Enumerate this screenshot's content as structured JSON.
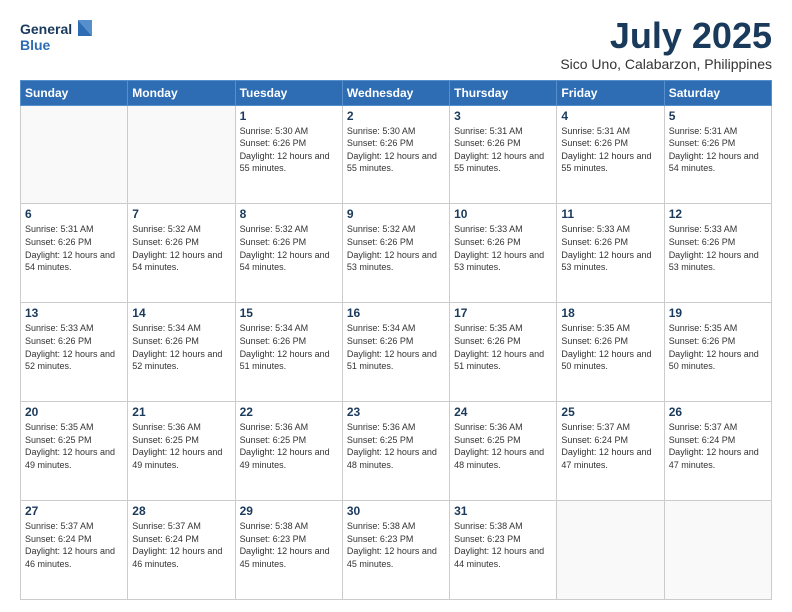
{
  "logo": {
    "line1": "General",
    "line2": "Blue"
  },
  "title": "July 2025",
  "subtitle": "Sico Uno, Calabarzon, Philippines",
  "weekdays": [
    "Sunday",
    "Monday",
    "Tuesday",
    "Wednesday",
    "Thursday",
    "Friday",
    "Saturday"
  ],
  "weeks": [
    [
      {
        "day": "",
        "info": ""
      },
      {
        "day": "",
        "info": ""
      },
      {
        "day": "1",
        "info": "Sunrise: 5:30 AM\nSunset: 6:26 PM\nDaylight: 12 hours and 55 minutes."
      },
      {
        "day": "2",
        "info": "Sunrise: 5:30 AM\nSunset: 6:26 PM\nDaylight: 12 hours and 55 minutes."
      },
      {
        "day": "3",
        "info": "Sunrise: 5:31 AM\nSunset: 6:26 PM\nDaylight: 12 hours and 55 minutes."
      },
      {
        "day": "4",
        "info": "Sunrise: 5:31 AM\nSunset: 6:26 PM\nDaylight: 12 hours and 55 minutes."
      },
      {
        "day": "5",
        "info": "Sunrise: 5:31 AM\nSunset: 6:26 PM\nDaylight: 12 hours and 54 minutes."
      }
    ],
    [
      {
        "day": "6",
        "info": "Sunrise: 5:31 AM\nSunset: 6:26 PM\nDaylight: 12 hours and 54 minutes."
      },
      {
        "day": "7",
        "info": "Sunrise: 5:32 AM\nSunset: 6:26 PM\nDaylight: 12 hours and 54 minutes."
      },
      {
        "day": "8",
        "info": "Sunrise: 5:32 AM\nSunset: 6:26 PM\nDaylight: 12 hours and 54 minutes."
      },
      {
        "day": "9",
        "info": "Sunrise: 5:32 AM\nSunset: 6:26 PM\nDaylight: 12 hours and 53 minutes."
      },
      {
        "day": "10",
        "info": "Sunrise: 5:33 AM\nSunset: 6:26 PM\nDaylight: 12 hours and 53 minutes."
      },
      {
        "day": "11",
        "info": "Sunrise: 5:33 AM\nSunset: 6:26 PM\nDaylight: 12 hours and 53 minutes."
      },
      {
        "day": "12",
        "info": "Sunrise: 5:33 AM\nSunset: 6:26 PM\nDaylight: 12 hours and 53 minutes."
      }
    ],
    [
      {
        "day": "13",
        "info": "Sunrise: 5:33 AM\nSunset: 6:26 PM\nDaylight: 12 hours and 52 minutes."
      },
      {
        "day": "14",
        "info": "Sunrise: 5:34 AM\nSunset: 6:26 PM\nDaylight: 12 hours and 52 minutes."
      },
      {
        "day": "15",
        "info": "Sunrise: 5:34 AM\nSunset: 6:26 PM\nDaylight: 12 hours and 51 minutes."
      },
      {
        "day": "16",
        "info": "Sunrise: 5:34 AM\nSunset: 6:26 PM\nDaylight: 12 hours and 51 minutes."
      },
      {
        "day": "17",
        "info": "Sunrise: 5:35 AM\nSunset: 6:26 PM\nDaylight: 12 hours and 51 minutes."
      },
      {
        "day": "18",
        "info": "Sunrise: 5:35 AM\nSunset: 6:26 PM\nDaylight: 12 hours and 50 minutes."
      },
      {
        "day": "19",
        "info": "Sunrise: 5:35 AM\nSunset: 6:26 PM\nDaylight: 12 hours and 50 minutes."
      }
    ],
    [
      {
        "day": "20",
        "info": "Sunrise: 5:35 AM\nSunset: 6:25 PM\nDaylight: 12 hours and 49 minutes."
      },
      {
        "day": "21",
        "info": "Sunrise: 5:36 AM\nSunset: 6:25 PM\nDaylight: 12 hours and 49 minutes."
      },
      {
        "day": "22",
        "info": "Sunrise: 5:36 AM\nSunset: 6:25 PM\nDaylight: 12 hours and 49 minutes."
      },
      {
        "day": "23",
        "info": "Sunrise: 5:36 AM\nSunset: 6:25 PM\nDaylight: 12 hours and 48 minutes."
      },
      {
        "day": "24",
        "info": "Sunrise: 5:36 AM\nSunset: 6:25 PM\nDaylight: 12 hours and 48 minutes."
      },
      {
        "day": "25",
        "info": "Sunrise: 5:37 AM\nSunset: 6:24 PM\nDaylight: 12 hours and 47 minutes."
      },
      {
        "day": "26",
        "info": "Sunrise: 5:37 AM\nSunset: 6:24 PM\nDaylight: 12 hours and 47 minutes."
      }
    ],
    [
      {
        "day": "27",
        "info": "Sunrise: 5:37 AM\nSunset: 6:24 PM\nDaylight: 12 hours and 46 minutes."
      },
      {
        "day": "28",
        "info": "Sunrise: 5:37 AM\nSunset: 6:24 PM\nDaylight: 12 hours and 46 minutes."
      },
      {
        "day": "29",
        "info": "Sunrise: 5:38 AM\nSunset: 6:23 PM\nDaylight: 12 hours and 45 minutes."
      },
      {
        "day": "30",
        "info": "Sunrise: 5:38 AM\nSunset: 6:23 PM\nDaylight: 12 hours and 45 minutes."
      },
      {
        "day": "31",
        "info": "Sunrise: 5:38 AM\nSunset: 6:23 PM\nDaylight: 12 hours and 44 minutes."
      },
      {
        "day": "",
        "info": ""
      },
      {
        "day": "",
        "info": ""
      }
    ]
  ]
}
